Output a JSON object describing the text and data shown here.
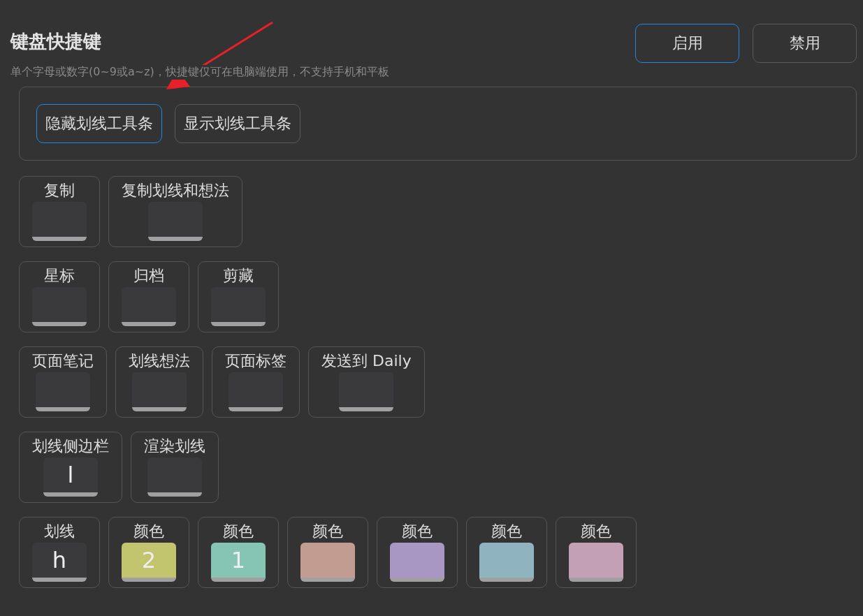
{
  "title": "键盘快捷键",
  "subtitle": "单个字母或数字(0~9或a~z)，快捷键仅可在电脑端使用，不支持手机和平板",
  "mode_buttons": [
    {
      "label": "启用",
      "selected": true
    },
    {
      "label": "禁用",
      "selected": false
    }
  ],
  "toolbar_buttons": [
    {
      "label": "隐藏划线工具条",
      "selected": true
    },
    {
      "label": "显示划线工具条",
      "selected": false
    }
  ],
  "shortcut_rows": [
    [
      {
        "label": "复制"
      },
      {
        "label": "复制划线和想法"
      }
    ],
    [
      {
        "label": "星标"
      },
      {
        "label": "归档"
      },
      {
        "label": "剪藏"
      }
    ],
    [
      {
        "label": "页面笔记"
      },
      {
        "label": "划线想法"
      },
      {
        "label": "页面标签"
      },
      {
        "label": "发送到 Daily"
      }
    ],
    [
      {
        "label": "划线侧边栏",
        "key": "l"
      },
      {
        "label": "渲染划线"
      }
    ],
    [
      {
        "label": "划线",
        "key": "h"
      },
      {
        "label": "颜色",
        "key": "2",
        "color": "#c3c46e"
      },
      {
        "label": "颜色",
        "key": "1",
        "color": "#86c4b4"
      },
      {
        "label": "颜色",
        "color": "#c29b91"
      },
      {
        "label": "颜色",
        "color": "#a797c2"
      },
      {
        "label": "颜色",
        "color": "#8fb4bf"
      },
      {
        "label": "颜色",
        "color": "#c3a0b4"
      }
    ]
  ]
}
